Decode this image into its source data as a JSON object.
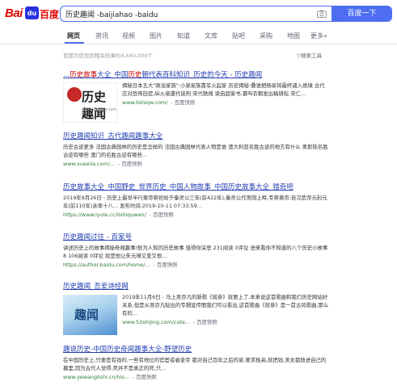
{
  "logo": {
    "bai": "Bai",
    "du": "du",
    "cn": "百度"
  },
  "search": {
    "query": "历史趣闻 -baijiahao -baidu",
    "button_label": "百度一下"
  },
  "nav": [
    "网页",
    "资讯",
    "视频",
    "图片",
    "知道",
    "文库",
    "贴吧",
    "采购",
    "地图",
    "更多»"
  ],
  "result_count": "百度为您找到相关结果约4,640,000个",
  "tools_label": "搜索工具",
  "snap_label": "- 百度快照",
  "results": [
    {
      "title_pre": "...",
      "title_hl": "历史故事",
      "title_mid": "大全_中国",
      "title_hl2": "历史",
      "title_post": "朝代表百科知识_历史的今天 - 历史趣闻",
      "abstract": "揭秘日本五大\"政治家族\":小泉家族靠军火起家 历史揭秘:叠谁把杨家将最终逼入绝境 古代应对恐怖旧症,纵火者遭代徒刑 宋代轶闻 梁启超家书,篡叫农朝发出稿耕耘 宋仁...",
      "url": "www.lishiqw.com/",
      "thumb_text": "历史趣闻",
      "thumb_sub": "www.lishiqw.com"
    },
    {
      "title": "历史趣闻知识_古代趣闻趣事大全",
      "abstract": "历史古迹更多 法国古典园林的历史是怎样的 法国古典园林代表人物是谁 澳大利亚名胜古迹的地方有什么 奥斯陆名胜古迹有哪些 澳门的名胜古迹有哪些...",
      "url": "www.xuexila.com/..."
    },
    {
      "title": "历史故事大全_中国野史_世界历史_中国人物故事_中国历史故事大全_猎奇吧",
      "abstract": "2019年9月26日 - 历史上最早半行黄帝祭祀始于秦灵公三年(前422年),秦灵公作吴阳上畤,专祭黄帝;自汉武帝元封元年(前110年)亲率十八... 发布时间:2019-10-11 07:33:59...",
      "url": "https://www.iyule.cc/lishiquwen/"
    },
    {
      "title": "历史趣闻过往 - 百家号",
      "abstract": "讲述历史上的故事揭秘奇闻趣事!鲜为人知的历史故事 值得你深思 231阅读 0评论 进来看你不知道的八个历史小故事 8 106阅读 0评论 就是他让朱元璋又爱又恨...",
      "url": "https://author.baidu.com/home/..."
    },
    {
      "title": "历史趣闻_吾爱诗经网",
      "abstract": "2019年11月6日 - 马上吴亦凡的新歌《就参》就要上了,本来说这首歌曲和我们历史网站好关系,但是从吴亦凡贴出的专辑宣传图我们可以看出,这首歌曲《就参》是一首古风歌曲,那么有的...",
      "url": "www.52shijing.com/cate...",
      "thumb_text": "趣闻"
    },
    {
      "title": "趣说历史-中国历史奇闻趣事大全-野望历史",
      "abstract": "在中国历史上,只要是有钱的,一些有地位的官宦或者皇帝 都对自己百年之后的家,要求极高,就把钱,美女都放进自己的墓里,因为古代人觉得,死并不是真正的死,只...",
      "url": "www.yewanglishi.cn/his..."
    }
  ],
  "colors": {
    "brand_blue": "#4e6ef2",
    "link_blue": "#2440b3",
    "highlight_red": "#c00",
    "url_green": "#2e7d32"
  }
}
